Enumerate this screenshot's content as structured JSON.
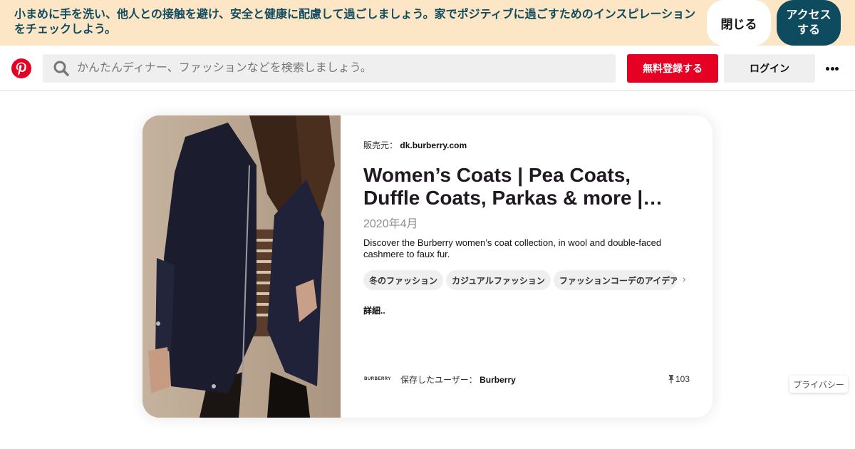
{
  "banner": {
    "text": "小まめに手を洗い、他人との接触を避け、安全と健康に配慮して過ごしましょう。家でポジティブに過ごすためのインスピレーションをチェックしよう。",
    "close_label": "閉じる",
    "access_label": "アクセスする",
    "bg_color": "#fde6c6",
    "accent_color": "#0f4b5e"
  },
  "header": {
    "logo_icon": "pinterest-logo",
    "search_placeholder": "かんたんディナー、ファッションなどを検索しましょう。",
    "signup_label": "無料登録する",
    "login_label": "ログイン",
    "more_icon": "ellipsis-icon",
    "brand_color": "#e60023"
  },
  "pin": {
    "source_label": "販売元：",
    "source_domain": "dk.burberry.com",
    "title": "Women’s Coats | Pea Coats, Duffle Coats, Parkas & more |…",
    "date": "2020年4月",
    "description": "Discover the Burberry women’s coat collection, in wool and double-faced cashmere to faux fur.",
    "tags": [
      "冬のファッション",
      "カジュアルファッション",
      "ファッションコーデのアイデア"
    ],
    "more_label": "詳細..",
    "saved_by_label": "保存したユーザー：",
    "saved_by_name": "Burberry",
    "brand_logo_text": "BURBERRY",
    "pin_count": "103"
  },
  "privacy_label": "プライバシー"
}
